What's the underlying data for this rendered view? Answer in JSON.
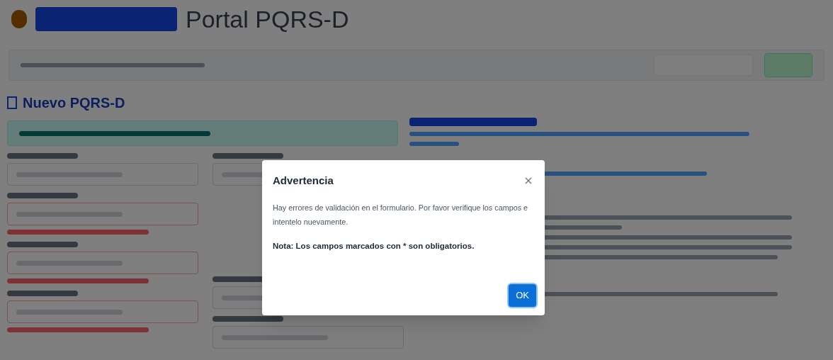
{
  "header": {
    "title": "Portal PQRS-D"
  },
  "page": {
    "heading": "Nuevo PQRS-D"
  },
  "dialog": {
    "title": "Advertencia",
    "message": "Hay errores de validación en el formulario. Por favor verifique los campos e intentelo nuevamente.",
    "note": "Nota: Los campos marcados con * son obligatorios.",
    "button": "OK"
  }
}
